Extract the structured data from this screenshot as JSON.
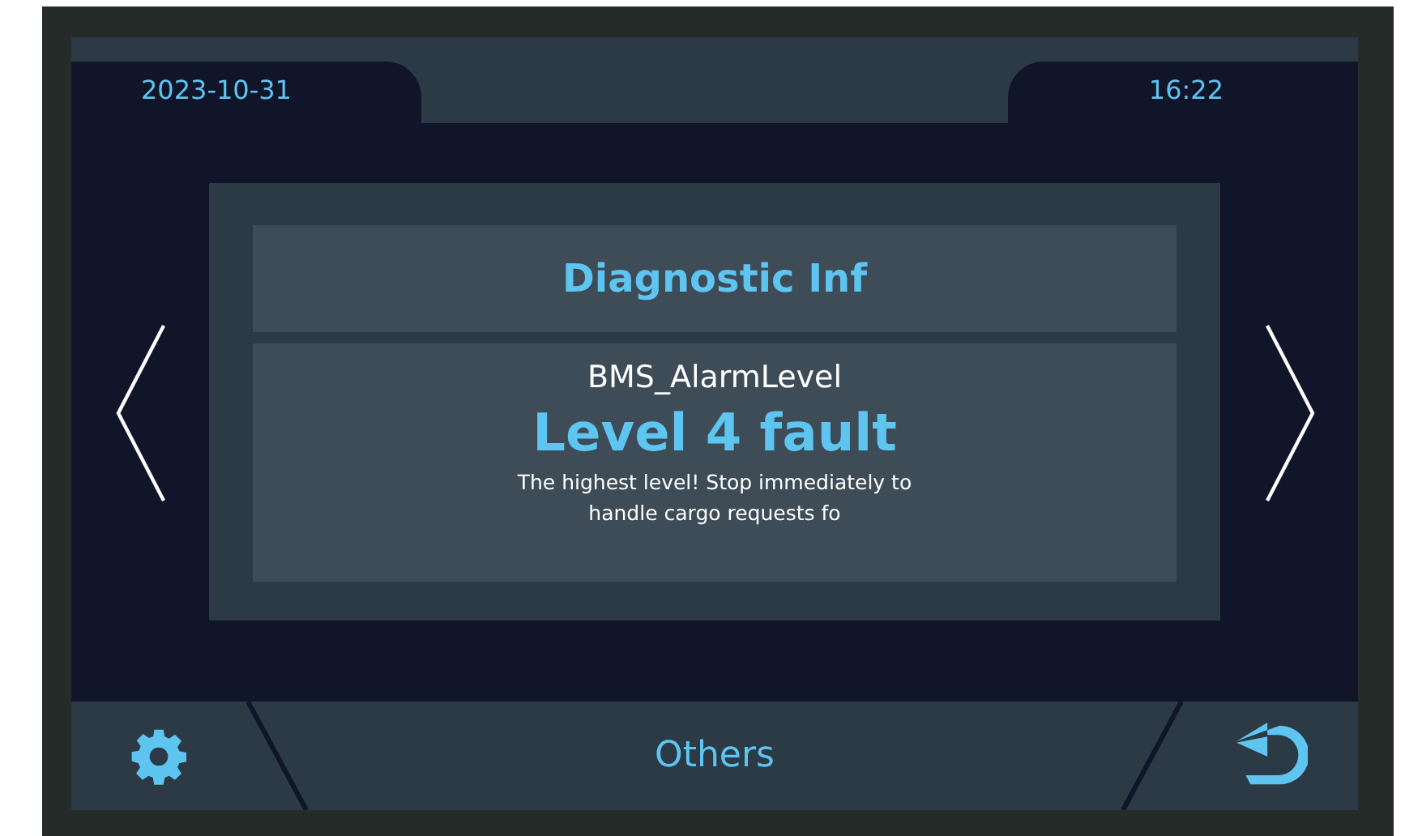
{
  "header": {
    "date": "2023-10-31",
    "time": "16:22"
  },
  "card": {
    "title": "Diagnostic Inf",
    "signal": "BMS_AlarmLevel",
    "value": "Level 4 fault",
    "description_lines": [
      "The highest level! Stop immediately to",
      "handle cargo requests fo"
    ]
  },
  "footer": {
    "title": "Others"
  }
}
